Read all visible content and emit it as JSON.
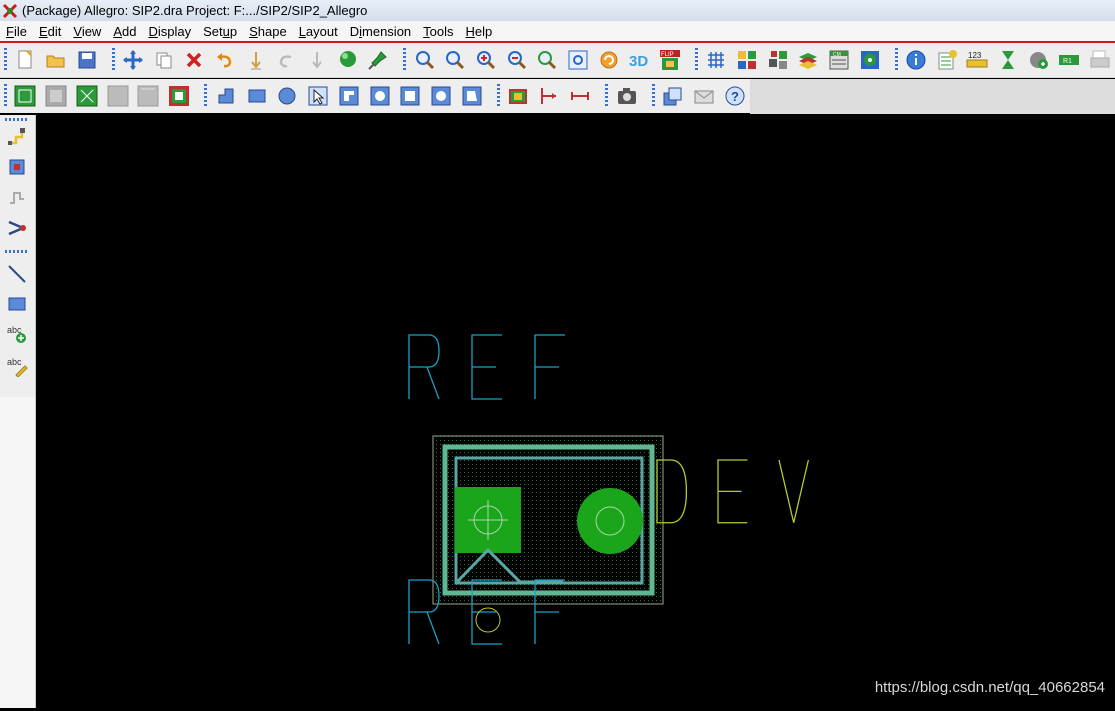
{
  "window": {
    "title": "(Package) Allegro: SIP2.dra  Project: F:.../SIP2/SIP2_Allegro"
  },
  "menu": [
    {
      "pre": "",
      "u": "F",
      "post": "ile"
    },
    {
      "pre": "",
      "u": "E",
      "post": "dit"
    },
    {
      "pre": "",
      "u": "V",
      "post": "iew"
    },
    {
      "pre": "",
      "u": "A",
      "post": "dd"
    },
    {
      "pre": "",
      "u": "D",
      "post": "isplay"
    },
    {
      "pre": "Set",
      "u": "u",
      "post": "p"
    },
    {
      "pre": "",
      "u": "S",
      "post": "hape"
    },
    {
      "pre": "",
      "u": "L",
      "post": "ayout"
    },
    {
      "pre": "D",
      "u": "i",
      "post": "mension"
    },
    {
      "pre": "",
      "u": "T",
      "post": "ools"
    },
    {
      "pre": "",
      "u": "H",
      "post": "elp"
    }
  ],
  "toolbar1": [
    {
      "icon": "new-icon"
    },
    {
      "icon": "open-icon"
    },
    {
      "icon": "save-icon"
    },
    {
      "sep": true
    },
    {
      "icon": "move-icon"
    },
    {
      "icon": "copy-icon"
    },
    {
      "icon": "delete-icon"
    },
    {
      "icon": "undo-icon"
    },
    {
      "icon": "done-icon"
    },
    {
      "icon": "redo-icon"
    },
    {
      "icon": "oops-icon"
    },
    {
      "icon": "pick-icon"
    },
    {
      "icon": "pin-icon"
    },
    {
      "sep": true
    },
    {
      "icon": "zoom-points-icon"
    },
    {
      "icon": "zoom-fit-icon"
    },
    {
      "icon": "zoom-in-icon"
    },
    {
      "icon": "zoom-out-icon"
    },
    {
      "icon": "zoom-previous-icon"
    },
    {
      "icon": "zoom-world-icon"
    },
    {
      "icon": "redraw-icon"
    },
    {
      "icon": "3d-view-icon"
    },
    {
      "icon": "flip-icon"
    },
    {
      "sep": true
    },
    {
      "icon": "grid-icon"
    },
    {
      "icon": "color-icon"
    },
    {
      "icon": "shadow-icon"
    },
    {
      "icon": "layers-icon"
    },
    {
      "icon": "constraint-manager-icon"
    },
    {
      "icon": "drc-icon"
    },
    {
      "sep": true
    },
    {
      "icon": "info-icon"
    },
    {
      "icon": "report-icon"
    },
    {
      "icon": "measure-icon"
    },
    {
      "icon": "hourglass-icon"
    },
    {
      "icon": "add-connect-icon"
    },
    {
      "icon": "refdes-icon"
    },
    {
      "icon": "print-icon"
    }
  ],
  "toolbar1_text": {
    "threeD": "3D",
    "flip": "FLIP",
    "measure": "123",
    "refdes": "R1",
    "cm": "CM"
  },
  "toolbar2": [
    {
      "icon": "shape-select-icon"
    },
    {
      "icon": "shape-void-icon"
    },
    {
      "icon": "shape-merge-icon"
    },
    {
      "icon": "shape-fill-icon"
    },
    {
      "icon": "shape-edit-icon"
    },
    {
      "icon": "shape-boundary-icon"
    },
    {
      "sep": true
    },
    {
      "icon": "polygon-icon"
    },
    {
      "icon": "rectangle-icon"
    },
    {
      "icon": "circle-icon"
    },
    {
      "icon": "select-shape-icon"
    },
    {
      "icon": "manual-void-icon"
    },
    {
      "icon": "circle-void-icon"
    },
    {
      "icon": "rect-void-icon"
    },
    {
      "icon": "delete-void-icon"
    },
    {
      "icon": "edit-boundary-icon"
    },
    {
      "sep": true
    },
    {
      "icon": "component-icon"
    },
    {
      "icon": "dimension-icon"
    },
    {
      "icon": "linear-dimension-icon"
    },
    {
      "sep": true
    },
    {
      "icon": "snapshot-icon"
    },
    {
      "sep": true
    },
    {
      "icon": "windows-icon"
    },
    {
      "icon": "mail-icon"
    },
    {
      "icon": "help-icon"
    }
  ],
  "leftbar": [
    {
      "icon": "route-icon"
    },
    {
      "icon": "place-icon"
    },
    {
      "icon": "slide-icon"
    },
    {
      "icon": "fanout-icon"
    },
    {
      "icon": "add-line-icon"
    },
    {
      "icon": "add-rect-icon"
    },
    {
      "icon": "add-text-icon"
    },
    {
      "icon": "edit-text-icon"
    }
  ],
  "leftbar_text": {
    "abc": "abc"
  },
  "design": {
    "ref_top": "REF",
    "dev": "DEV",
    "ref_bottom": "REF",
    "colors": {
      "ref_top": "#1f9ec5",
      "dev": "#b8c832",
      "ref_bottom": "#1f9ec5",
      "pad": "#1aa51a",
      "outline": "#5fb892",
      "assembly": "#5aa5a5"
    }
  },
  "watermark": "https://blog.csdn.net/qq_40662854"
}
